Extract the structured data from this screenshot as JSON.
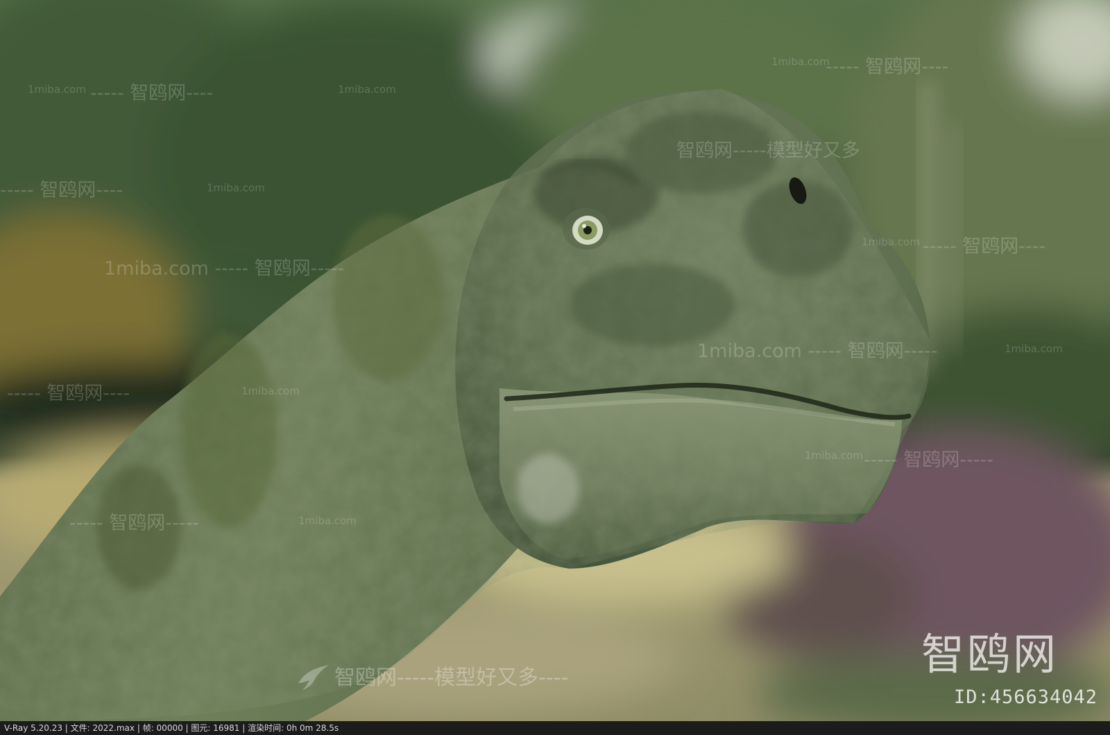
{
  "watermarks": {
    "main": "智鸥网-----模型好又多----",
    "site": "智鸥网",
    "url": "1miba.com",
    "slogan": "智鸥网-----模型好又多",
    "row": "1miba.com -----  智鸥网",
    "row2": "-----  智鸥网----",
    "row3": "1miba.com -----  智鸥网-----",
    "row4": "-----  智鸥网-----"
  },
  "logo": {
    "text": "智鸥网",
    "id": "ID:456634042"
  },
  "status_bar": {
    "renderer": "V-Ray 5.20.23",
    "file": "文件: 2022.max",
    "frame": "帧: 00000",
    "primitives": "图元: 16981",
    "render_time": "渲染时间:  0h  0m 28.5s",
    "separator": " | "
  },
  "colors": {
    "skin": "#62734f",
    "skin_light": "#8a977a",
    "background_foliage": "#4d6040",
    "ground": "#b3a878",
    "status_bar_bg": "#1c1c1c"
  }
}
